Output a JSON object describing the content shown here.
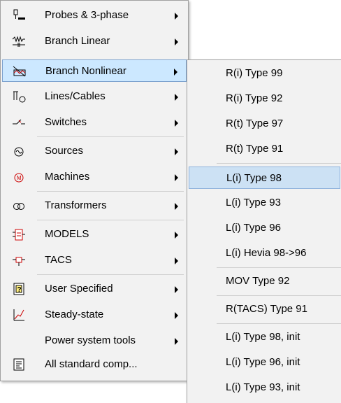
{
  "main_menu": {
    "items": [
      {
        "label": "Probes & 3-phase",
        "icon": "probe-icon",
        "submenu": true
      },
      {
        "label": "Branch Linear",
        "icon": "branch-linear-icon",
        "submenu": true
      },
      {
        "label": "Branch Nonlinear",
        "icon": "branch-nonlinear-icon",
        "submenu": true,
        "highlighted": true
      },
      {
        "label": "Lines/Cables",
        "icon": "lines-cables-icon",
        "submenu": true
      },
      {
        "label": "Switches",
        "icon": "switch-icon",
        "submenu": true
      },
      {
        "label": "Sources",
        "icon": "source-icon",
        "submenu": true
      },
      {
        "label": "Machines",
        "icon": "machine-icon",
        "submenu": true
      },
      {
        "label": "Transformers",
        "icon": "transformer-icon",
        "submenu": true
      },
      {
        "label": "MODELS",
        "icon": "models-icon",
        "submenu": true
      },
      {
        "label": "TACS",
        "icon": "tacs-icon",
        "submenu": true
      },
      {
        "label": "User Specified",
        "icon": "user-specified-icon",
        "submenu": true
      },
      {
        "label": "Steady-state",
        "icon": "steady-state-icon",
        "submenu": true
      },
      {
        "label": "Power system tools",
        "icon": "",
        "submenu": true
      },
      {
        "label": "All standard comp...",
        "icon": "all-components-icon",
        "submenu": false
      }
    ]
  },
  "sub_menu": {
    "items": [
      {
        "label": "R(i) Type 99"
      },
      {
        "label": "R(i) Type 92"
      },
      {
        "label": "R(t) Type 97"
      },
      {
        "label": "R(t) Type 91"
      },
      {
        "label": "L(i) Type 98",
        "highlighted": true
      },
      {
        "label": "L(i) Type 93"
      },
      {
        "label": "L(i) Type 96"
      },
      {
        "label": "L(i) Hevia 98->96"
      },
      {
        "label": "MOV Type 92"
      },
      {
        "label": "R(TACS) Type 91"
      },
      {
        "label": "L(i) Type 98, init"
      },
      {
        "label": "L(i) Type 96, init"
      },
      {
        "label": "L(i) Type 93, init"
      }
    ]
  },
  "colors": {
    "menu_bg": "#f2f2f2",
    "highlight": "#cce8ff",
    "highlight_border": "#7da2ce"
  }
}
